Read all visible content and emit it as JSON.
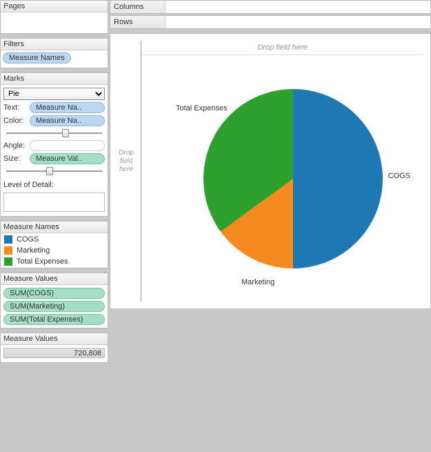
{
  "sidebar": {
    "pages_title": "Pages",
    "filters_title": "Filters",
    "filters_item": "Measure Names",
    "marks_title": "Marks",
    "marks_type": "Pie",
    "marks_text_label": "Text:",
    "marks_text_value": "Measure Na..",
    "marks_color_label": "Color:",
    "marks_color_value": "Measure Na..",
    "marks_angle_label": "Angle:",
    "marks_size_label": "Size:",
    "marks_size_value": "Measure Val..",
    "lod_label": "Level of Detail:",
    "legend_title": "Measure Names",
    "legend": [
      {
        "label": "COGS",
        "color": "#1e78b4"
      },
      {
        "label": "Marketing",
        "color": "#f58a1f"
      },
      {
        "label": "Total Expenses",
        "color": "#2ea02e"
      }
    ],
    "mv_title": "Measure Values",
    "mv_items": [
      "SUM(COGS)",
      "SUM(Marketing)",
      "SUM(Total Expenses)"
    ],
    "mv2_title": "Measure Values",
    "mv2_value": "720,808"
  },
  "shelves": {
    "columns_label": "Columns",
    "rows_label": "Rows"
  },
  "viz": {
    "drop_hint_top": "Drop field here",
    "drop_hint_left": "Drop field here"
  },
  "chart_data": {
    "type": "pie",
    "title": "",
    "series": [
      {
        "name": "COGS",
        "value": 50,
        "color": "#1e78b4"
      },
      {
        "name": "Marketing",
        "value": 15,
        "color": "#f58a1f"
      },
      {
        "name": "Total Expenses",
        "value": 35,
        "color": "#2ea02e"
      }
    ],
    "labels": [
      "COGS",
      "Marketing",
      "Total Expenses"
    ]
  }
}
